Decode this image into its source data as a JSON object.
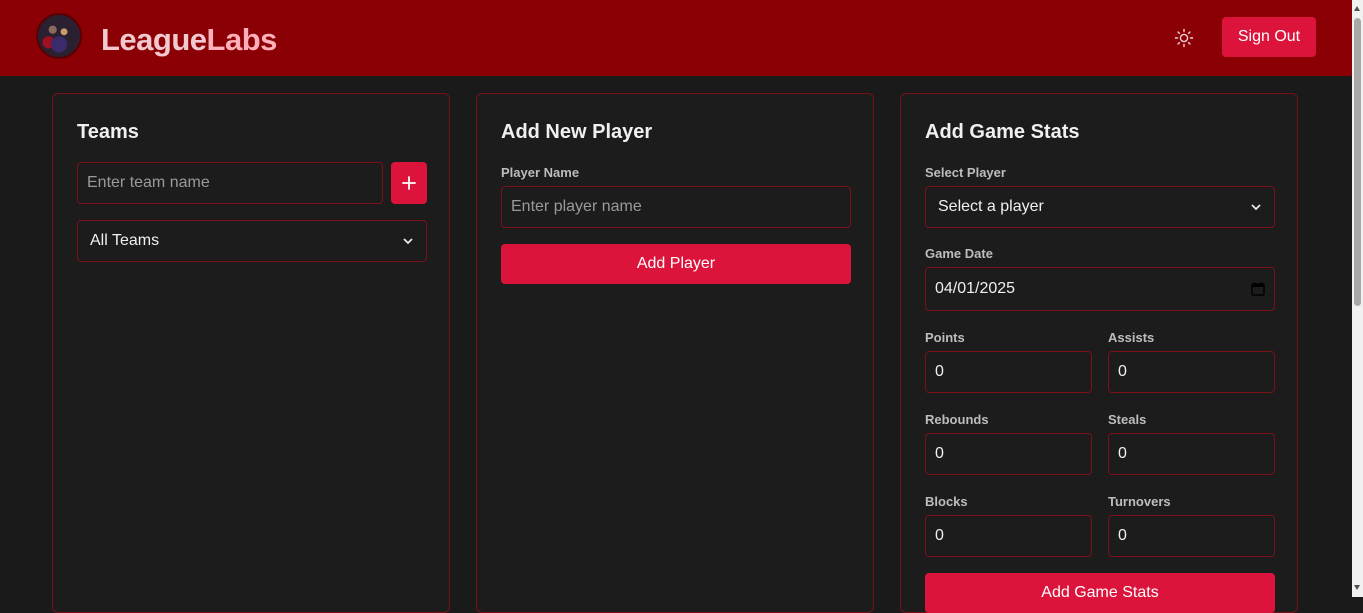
{
  "header": {
    "brand_part1": "League",
    "brand_part2": "Labs",
    "signout_label": "Sign Out",
    "theme_icon": "sun-icon"
  },
  "teams_card": {
    "title": "Teams",
    "team_name_placeholder": "Enter team name",
    "add_icon": "+",
    "filter_selected": "All Teams"
  },
  "player_card": {
    "title": "Add New Player",
    "player_name_label": "Player Name",
    "player_name_placeholder": "Enter player name",
    "add_button": "Add Player"
  },
  "stats_card": {
    "title": "Add Game Stats",
    "select_player_label": "Select Player",
    "select_player_value": "Select a player",
    "game_date_label": "Game Date",
    "game_date_value": "04/01/2025",
    "points_label": "Points",
    "points_value": "0",
    "assists_label": "Assists",
    "assists_value": "0",
    "rebounds_label": "Rebounds",
    "rebounds_value": "0",
    "steals_label": "Steals",
    "steals_value": "0",
    "blocks_label": "Blocks",
    "blocks_value": "0",
    "turnovers_label": "Turnovers",
    "turnovers_value": "0",
    "submit_button": "Add Game Stats"
  },
  "colors": {
    "header_bg": "#8b0005",
    "accent": "#dc143c",
    "background": "#1a1a1a",
    "border": "#7a1018"
  }
}
